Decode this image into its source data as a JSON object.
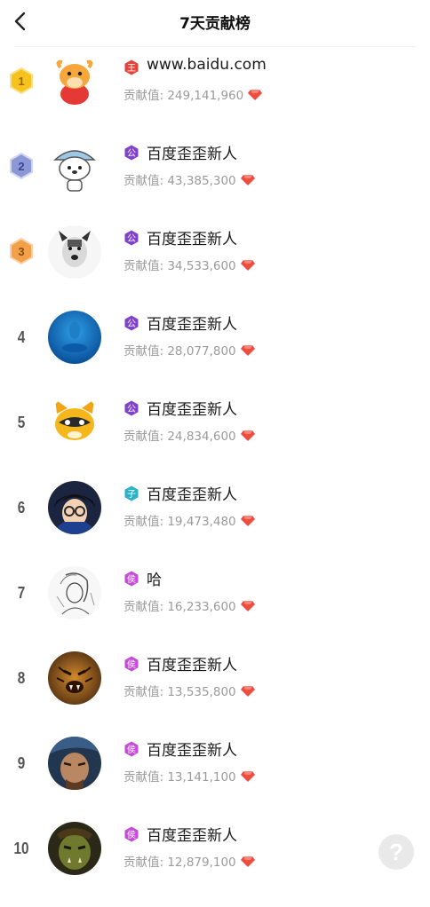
{
  "header": {
    "title": "7天贡献榜"
  },
  "score_label": "贡献值: ",
  "rows": [
    {
      "rank": "1",
      "level": "王",
      "level_color": "#e2433a",
      "name": "www.baidu.com",
      "score": "249,141,960"
    },
    {
      "rank": "2",
      "level": "公",
      "level_color": "#7f43c9",
      "name": "百度歪歪新人",
      "score": "43,385,300"
    },
    {
      "rank": "3",
      "level": "公",
      "level_color": "#7f43c9",
      "name": "百度歪歪新人",
      "score": "34,533,600"
    },
    {
      "rank": "4",
      "level": "公",
      "level_color": "#7f43c9",
      "name": "百度歪歪新人",
      "score": "28,077,800"
    },
    {
      "rank": "5",
      "level": "公",
      "level_color": "#7f43c9",
      "name": "百度歪歪新人",
      "score": "24,834,600"
    },
    {
      "rank": "6",
      "level": "子",
      "level_color": "#29b3c9",
      "name": "百度歪歪新人",
      "score": "19,473,480"
    },
    {
      "rank": "7",
      "level": "侯",
      "level_color": "#c74bd9",
      "name": "哈",
      "score": "16,233,600"
    },
    {
      "rank": "8",
      "level": "侯",
      "level_color": "#c74bd9",
      "name": "百度歪歪新人",
      "score": "13,535,800"
    },
    {
      "rank": "9",
      "level": "侯",
      "level_color": "#c74bd9",
      "name": "百度歪歪新人",
      "score": "13,141,100"
    },
    {
      "rank": "10",
      "level": "侯",
      "level_color": "#c74bd9",
      "name": "百度歪歪新人",
      "score": "12,879,100"
    }
  ],
  "help": {
    "label": "?"
  }
}
